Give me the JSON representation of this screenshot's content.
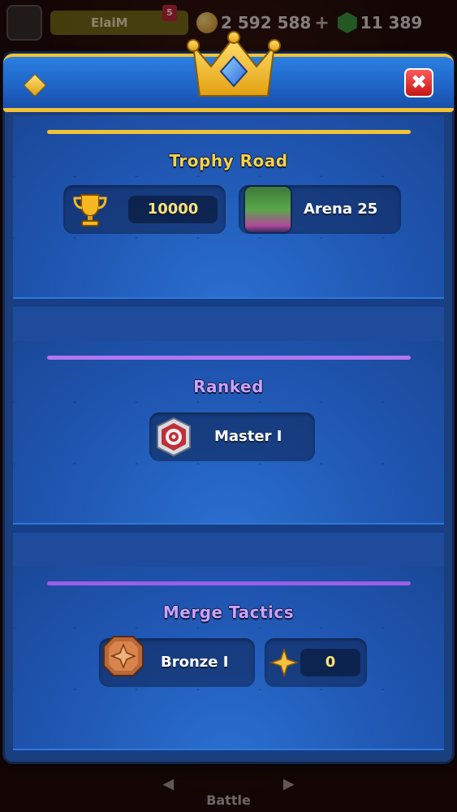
{
  "topbar": {
    "player_name": "ElaiM",
    "badge": "5",
    "gold": "2 592 588",
    "gems": "11 389",
    "plus": "+"
  },
  "modal": {
    "close_label": "✖",
    "trophy_road": {
      "title": "Trophy Road",
      "trophies": "10000",
      "arena": "Arena 25",
      "accent": "#f3c234"
    },
    "ranked": {
      "title": "Ranked",
      "league": "Master I",
      "accent": "#b277f0"
    },
    "merge_tactics": {
      "title": "Merge Tactics",
      "league": "Bronze I",
      "stars": "0",
      "accent": "#b277f0"
    }
  },
  "bottom_nav": {
    "battle_label": "Battle"
  },
  "icons": {
    "header_left": "diamond-icon",
    "crown": "crown-icon",
    "trophy": "trophy-icon",
    "arena": "arena-image",
    "ranked": "ranked-badge-icon",
    "merge": "bronze-badge-icon",
    "star": "star-icon"
  }
}
